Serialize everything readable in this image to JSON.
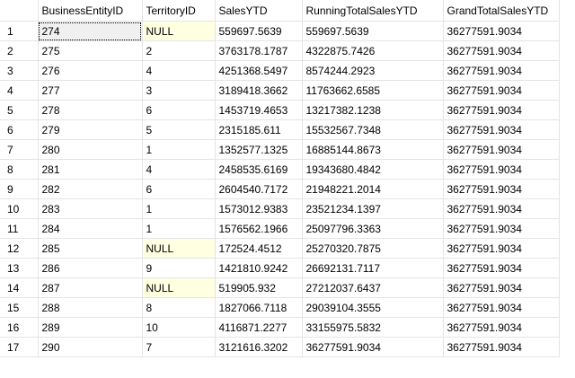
{
  "grid": {
    "columns": [
      "",
      "BusinessEntityID",
      "TerritoryID",
      "SalesYTD",
      "RunningTotalSalesYTD",
      "GrandTotalSalesYTD"
    ],
    "null_color": "#ffffe1",
    "rows": [
      [
        "1",
        "274",
        "NULL",
        "559697.5639",
        "559697.5639",
        "36277591.9034"
      ],
      [
        "2",
        "275",
        "2",
        "3763178.1787",
        "4322875.7426",
        "36277591.9034"
      ],
      [
        "3",
        "276",
        "4",
        "4251368.5497",
        "8574244.2923",
        "36277591.9034"
      ],
      [
        "4",
        "277",
        "3",
        "3189418.3662",
        "11763662.6585",
        "36277591.9034"
      ],
      [
        "5",
        "278",
        "6",
        "1453719.4653",
        "13217382.1238",
        "36277591.9034"
      ],
      [
        "6",
        "279",
        "5",
        "2315185.611",
        "15532567.7348",
        "36277591.9034"
      ],
      [
        "7",
        "280",
        "1",
        "1352577.1325",
        "16885144.8673",
        "36277591.9034"
      ],
      [
        "8",
        "281",
        "4",
        "2458535.6169",
        "19343680.4842",
        "36277591.9034"
      ],
      [
        "9",
        "282",
        "6",
        "2604540.7172",
        "21948221.2014",
        "36277591.9034"
      ],
      [
        "10",
        "283",
        "1",
        "1573012.9383",
        "23521234.1397",
        "36277591.9034"
      ],
      [
        "11",
        "284",
        "1",
        "1576562.1966",
        "25097796.3363",
        "36277591.9034"
      ],
      [
        "12",
        "285",
        "NULL",
        "172524.4512",
        "25270320.7875",
        "36277591.9034"
      ],
      [
        "13",
        "286",
        "9",
        "1421810.9242",
        "26692131.7117",
        "36277591.9034"
      ],
      [
        "14",
        "287",
        "NULL",
        "519905.932",
        "27212037.6437",
        "36277591.9034"
      ],
      [
        "15",
        "288",
        "8",
        "1827066.7118",
        "29039104.3555",
        "36277591.9034"
      ],
      [
        "16",
        "289",
        "10",
        "4116871.2277",
        "33155975.5832",
        "36277591.9034"
      ],
      [
        "17",
        "290",
        "7",
        "3121616.3202",
        "36277591.9034",
        "36277591.9034"
      ]
    ]
  }
}
